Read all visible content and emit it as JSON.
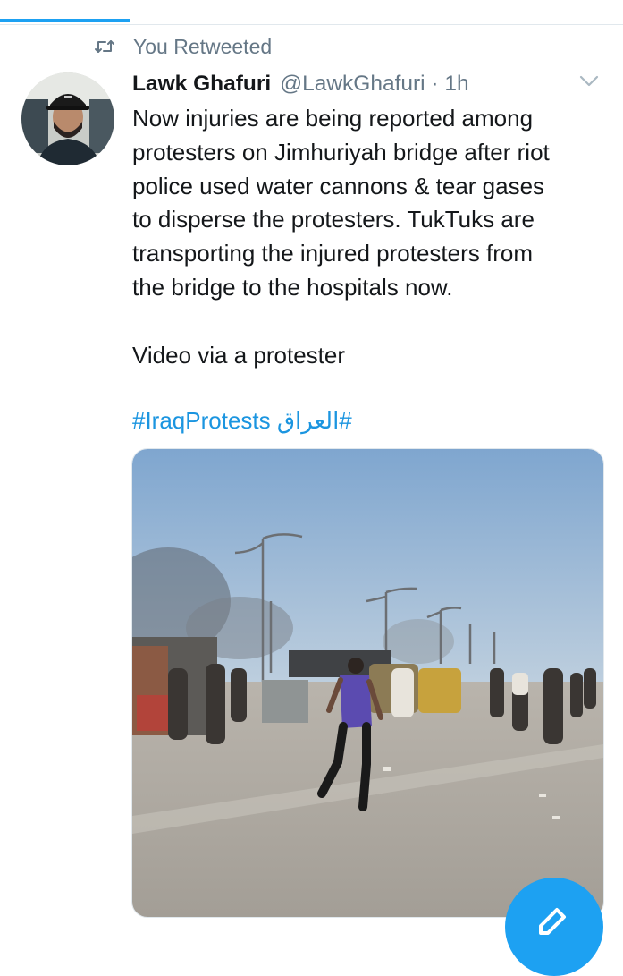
{
  "retweet": {
    "label": "You Retweeted",
    "icon": "retweet-icon"
  },
  "tweet": {
    "author_name": "Lawk Ghafuri",
    "author_handle": "@LawkGhafuri · 1h",
    "body_lines": [
      "Now injuries are being reported among",
      "protesters on Jimhuriyah bridge after riot",
      "police used water cannons & tear gases",
      "to disperse the protesters. TukTuks are",
      "transporting the injured protesters from",
      "the bridge to the hospitals now."
    ],
    "source_line": "Video via a protester",
    "hashtag_1": "#IraqProtests",
    "hashtag_2": "#العراق"
  },
  "media": {
    "type": "video",
    "description_icon": "video-thumbnail"
  },
  "fab": {
    "icon": "compose-icon"
  },
  "colors": {
    "accent": "#1da1f2",
    "link": "#1b95e0",
    "secondary_text": "#657786",
    "primary_text": "#14171a"
  }
}
